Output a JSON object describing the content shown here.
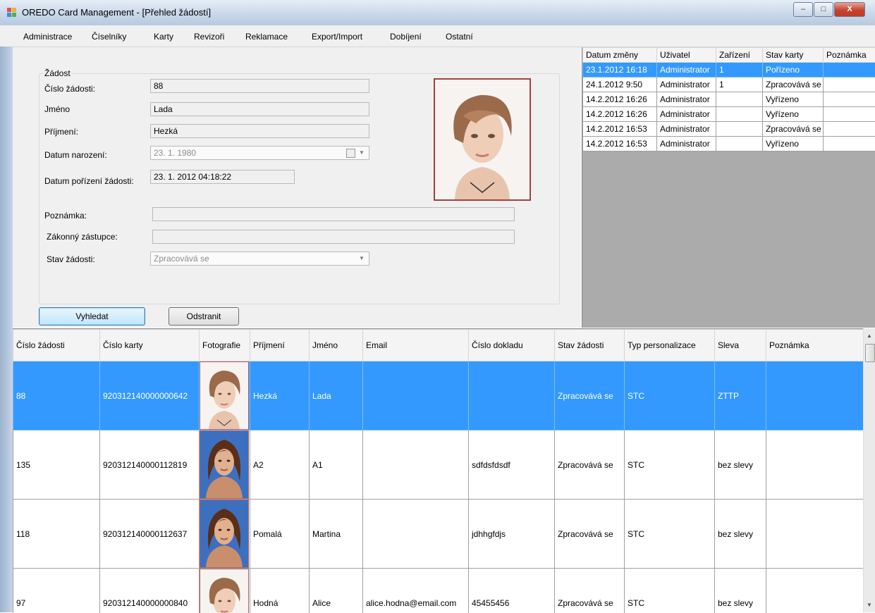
{
  "window": {
    "title": "OREDO Card Management - [Přehled žádostí]",
    "buttons": {
      "minimize": "–",
      "maximize": "□",
      "close": "X"
    }
  },
  "menu": [
    "Administrace",
    "Číselníky",
    "Karty",
    "Revizoři",
    "Reklamace",
    "Export/Import",
    "Dobíjení",
    "Ostatní"
  ],
  "form": {
    "group_title": "Žádost",
    "labels": {
      "request_no": "Číslo žádosti:",
      "first_name": "Jméno",
      "last_name": "Příjmení:",
      "birth_date": "Datum narození:",
      "created": "Datum pořízení žádosti:",
      "note": "Poznámka:",
      "guardian": "Zákonný zástupce:",
      "status": "Stav žádosti:"
    },
    "values": {
      "request_no": "88",
      "first_name": "Lada",
      "last_name": "Hezká",
      "birth_date": "23.  1. 1980",
      "created": "23. 1. 2012 04:18:22",
      "note": "",
      "guardian": "",
      "status": "Zpracovává se"
    },
    "buttons": {
      "search": "Vyhledat",
      "delete": "Odstranit"
    }
  },
  "history": {
    "columns": [
      "Datum změny",
      "Uživatel",
      "Zařízení",
      "Stav karty",
      "Poznámka"
    ],
    "rows": [
      [
        "23.1.2012 16:18",
        "Administrator",
        "1",
        "Pořízeno",
        ""
      ],
      [
        "24.1.2012 9:50",
        "Administrator",
        "1",
        "Zpracovává se",
        ""
      ],
      [
        "14.2.2012 16:26",
        "Administrator",
        "",
        "Vyřízeno",
        ""
      ],
      [
        "14.2.2012 16:26",
        "Administrator",
        "",
        "Vyřízeno",
        ""
      ],
      [
        "14.2.2012 16:53",
        "Administrator",
        "",
        "Zpracovává se",
        ""
      ],
      [
        "14.2.2012 16:53",
        "Administrator",
        "",
        "Vyřízeno",
        ""
      ]
    ],
    "selected_row": 0
  },
  "grid": {
    "columns": [
      "Číslo žádosti",
      "Číslo karty",
      "Fotografie",
      "Příjmení",
      "Jméno",
      "Email",
      "Číslo dokladu",
      "Stav žádosti",
      "Typ personalizace",
      "Sleva",
      "Poznámka"
    ],
    "rows": [
      {
        "no": "88",
        "card": "920312140000000642",
        "photo": "short-hair-woman",
        "last": "Hezká",
        "first": "Lada",
        "email": "",
        "doc": "",
        "status": "Zpracovává se",
        "type": "STC",
        "discount": "ZTTP",
        "note": ""
      },
      {
        "no": "135",
        "card": "920312140000112819",
        "photo": "long-hair-woman",
        "last": "A2",
        "first": "A1",
        "email": "",
        "doc": "sdfdsfdsdf",
        "status": "Zpracovává se",
        "type": "STC",
        "discount": "bez slevy",
        "note": ""
      },
      {
        "no": "118",
        "card": "920312140000112637",
        "photo": "long-hair-woman",
        "last": "Pomalá",
        "first": "Martina",
        "email": "",
        "doc": "jdhhgfdjs",
        "status": "Zpracovává se",
        "type": "STC",
        "discount": "bez slevy",
        "note": ""
      },
      {
        "no": "97",
        "card": "920312140000000840",
        "photo": "short-hair-woman",
        "last": "Hodná",
        "first": "Alice",
        "email": "alice.hodna@email.com",
        "doc": "45455456",
        "status": "Zpracovává se",
        "type": "STC",
        "discount": "bez slevy",
        "note": ""
      }
    ],
    "selected_row": 0
  },
  "colors": {
    "selection": "#3399ff",
    "grid_background": "#ababab",
    "panel": "#f0f0f0"
  }
}
